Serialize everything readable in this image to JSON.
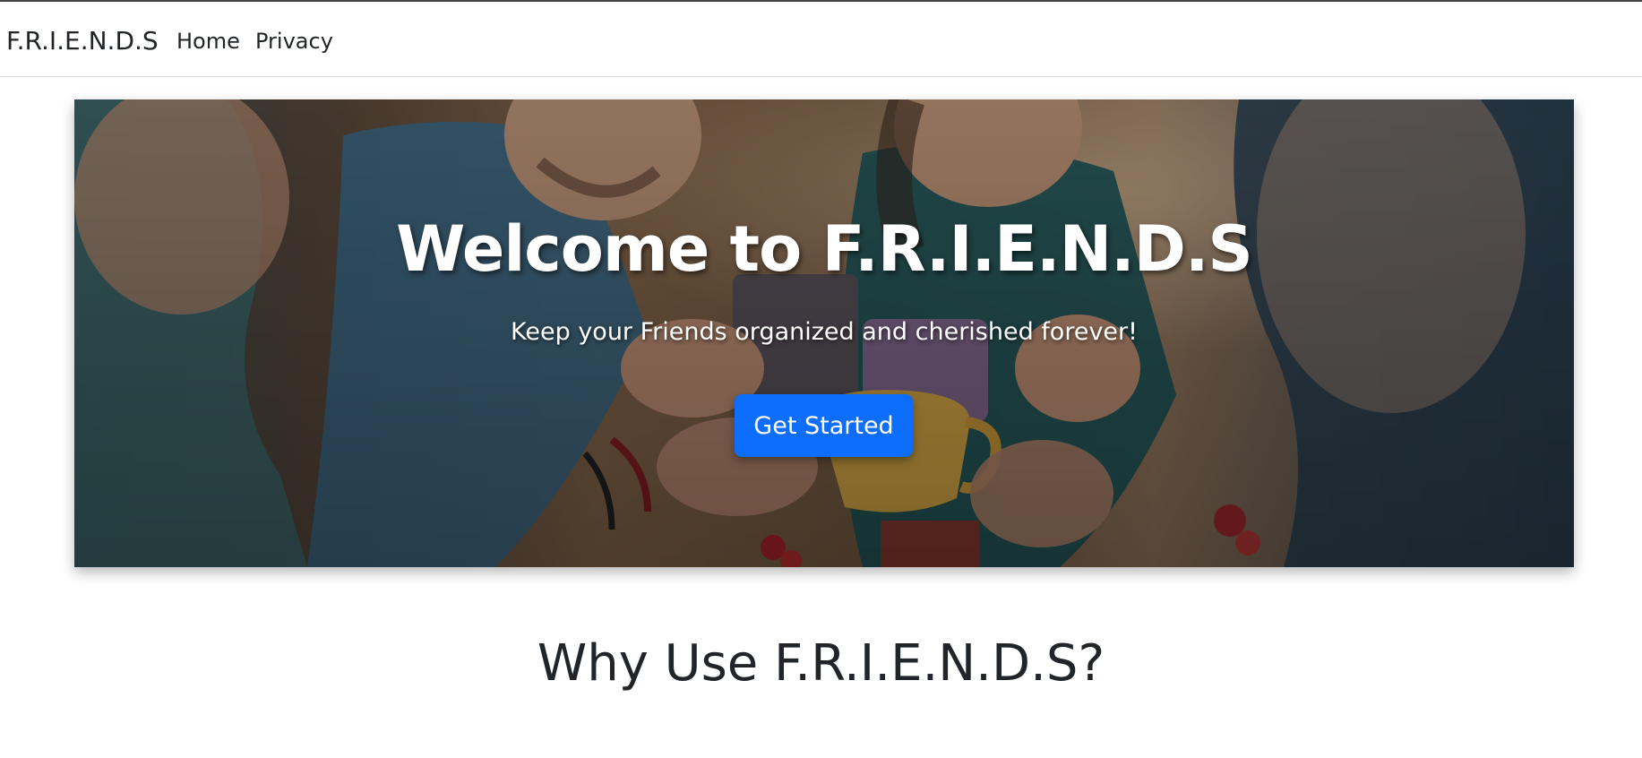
{
  "navbar": {
    "brand": "F.R.I.E.N.D.S",
    "links": [
      {
        "label": "Home"
      },
      {
        "label": "Privacy"
      }
    ]
  },
  "hero": {
    "title": "Welcome to F.R.I.E.N.D.S",
    "subtitle": "Keep your Friends organized and cherished forever!",
    "cta_label": "Get Started",
    "cta_color": "#0d6efd"
  },
  "features": {
    "heading": "Why Use F.R.I.E.N.D.S?"
  }
}
